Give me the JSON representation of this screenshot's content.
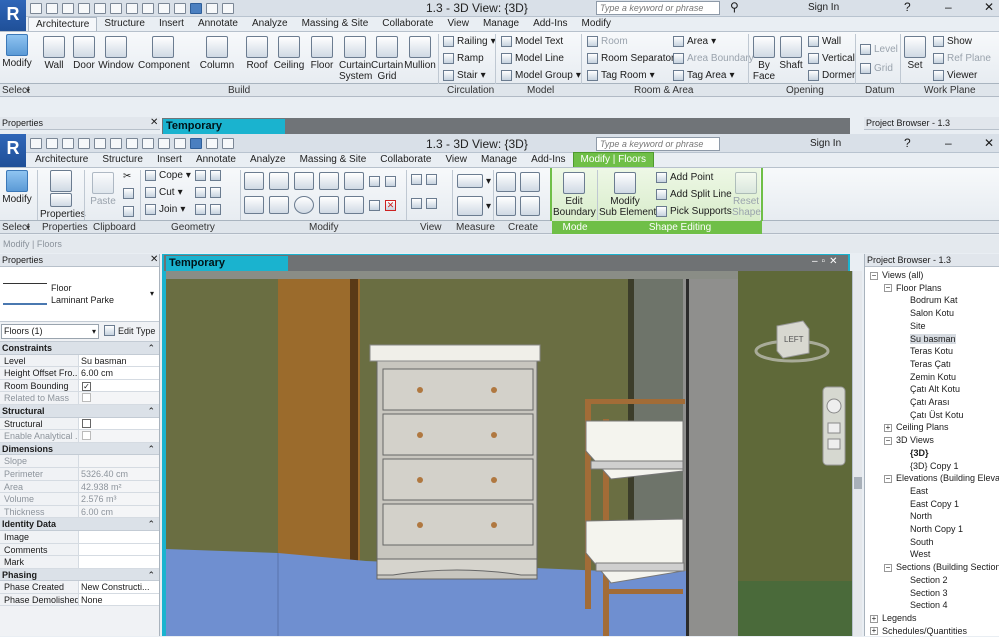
{
  "app": {
    "logo_letter": "R"
  },
  "top_window": {
    "title": "1.3 - 3D View: {3D}",
    "search_placeholder": "Type a keyword or phrase",
    "sign_in": "Sign In",
    "tabs": [
      "Architecture",
      "Structure",
      "Insert",
      "Annotate",
      "Analyze",
      "Massing & Site",
      "Collaborate",
      "View",
      "Manage",
      "Add-Ins",
      "Modify"
    ],
    "active_tab": "Architecture",
    "buttons": {
      "modify": "Modify",
      "wall": "Wall",
      "door": "Door",
      "window": "Window",
      "component": "Component",
      "column": "Column",
      "roof": "Roof",
      "ceiling": "Ceiling",
      "floor": "Floor",
      "curtain_system": "Curtain\nSystem",
      "curtain_grid": "Curtain\nGrid",
      "mullion": "Mullion",
      "railing": "Railing",
      "ramp": "Ramp",
      "stair": "Stair",
      "model_text": "Model  Text",
      "model_line": "Model  Line",
      "model_group": "Model  Group",
      "room": "Room",
      "room_separator": "Room  Separator",
      "tag_room": "Tag  Room",
      "area": "Area",
      "area_boundary": "Area  Boundary",
      "tag_area": "Tag  Area",
      "by_face": "By\nFace",
      "shaft": "Shaft",
      "wall_opening": "Wall",
      "vertical": "Vertical",
      "dormer": "Dormer",
      "level": "Level",
      "grid": "Grid",
      "set": "Set",
      "show": "Show",
      "ref_plane": "Ref  Plane",
      "viewer": "Viewer"
    },
    "panels": {
      "select": "Select",
      "build": "Build",
      "circulation": "Circulation",
      "model": "Model",
      "room_area": "Room & Area",
      "opening": "Opening",
      "datum": "Datum",
      "work_plane": "Work Plane"
    },
    "properties_label": "Properties",
    "view_title": "Temporary Hide/Isolate",
    "project_browser_label": "Project Browser - 1.3"
  },
  "window": {
    "title": "1.3 - 3D View: {3D}",
    "search_placeholder": "Type a keyword or phrase",
    "sign_in": "Sign In",
    "tabs": [
      "Architecture",
      "Structure",
      "Insert",
      "Annotate",
      "Analyze",
      "Massing & Site",
      "Collaborate",
      "View",
      "Manage",
      "Add-Ins",
      "Modify | Floors"
    ],
    "active_tab": "Modify | Floors",
    "buttons": {
      "modify": "Modify",
      "properties": "Properties",
      "paste": "Paste",
      "cope": "Cope",
      "cut": "Cut",
      "join": "Join",
      "edit_boundary": "Edit\nBoundary",
      "modify_sub": "Modify\nSub Elements",
      "add_point": "Add Point",
      "add_split_line": "Add Split Line",
      "pick_supports": "Pick Supports",
      "reset_shape": "Reset\nShape"
    },
    "panels": {
      "select": "Select",
      "properties": "Properties",
      "clipboard": "Clipboard",
      "geometry": "Geometry",
      "modify": "Modify",
      "view": "View",
      "measure": "Measure",
      "create": "Create",
      "mode": "Mode",
      "shape_editing": "Shape Editing"
    },
    "status_line": "Modify | Floors"
  },
  "properties": {
    "header": "Properties",
    "type_family": "Floor",
    "type_name": "Laminant Parke",
    "selector": "Floors (1)",
    "edit_type": "Edit Type",
    "groups": [
      {
        "name": "Constraints",
        "rows": [
          {
            "k": "Level",
            "v": "Su basman",
            "checkbox": false
          },
          {
            "k": "Height Offset Fro...",
            "v": "6.00 cm",
            "checkbox": false
          },
          {
            "k": "Room Bounding",
            "v": "✓",
            "checkbox": true
          },
          {
            "k": "Related to Mass",
            "v": "",
            "checkbox": true,
            "dim": true
          }
        ]
      },
      {
        "name": "Structural",
        "rows": [
          {
            "k": "Structural",
            "v": "",
            "checkbox": true
          },
          {
            "k": "Enable Analytical ...",
            "v": "",
            "checkbox": true,
            "dim": true
          }
        ]
      },
      {
        "name": "Dimensions",
        "rows": [
          {
            "k": "Slope",
            "v": "",
            "dim": true
          },
          {
            "k": "Perimeter",
            "v": "5326.40 cm",
            "dim": true
          },
          {
            "k": "Area",
            "v": "42.938 m²",
            "dim": true
          },
          {
            "k": "Volume",
            "v": "2.576 m³",
            "dim": true
          },
          {
            "k": "Thickness",
            "v": "6.00 cm",
            "dim": true
          }
        ]
      },
      {
        "name": "Identity Data",
        "rows": [
          {
            "k": "Image",
            "v": ""
          },
          {
            "k": "Comments",
            "v": ""
          },
          {
            "k": "Mark",
            "v": ""
          }
        ]
      },
      {
        "name": "Phasing",
        "rows": [
          {
            "k": "Phase Created",
            "v": "New Constructi..."
          },
          {
            "k": "Phase Demolished",
            "v": "None"
          }
        ]
      }
    ]
  },
  "viewport": {
    "title": "Temporary Hide/Isolate",
    "viewcube_face": "LEFT"
  },
  "project_browser": {
    "header": "Project Browser - 1.3",
    "items": [
      {
        "label": "Views (all)",
        "level": 0,
        "toggle": "−"
      },
      {
        "label": "Floor Plans",
        "level": 1,
        "toggle": "−"
      },
      {
        "label": "Bodrum Kat",
        "level": 2
      },
      {
        "label": "Salon Kotu",
        "level": 2
      },
      {
        "label": "Site",
        "level": 2
      },
      {
        "label": "Su basman",
        "level": 2,
        "selected": true
      },
      {
        "label": "Teras Kotu",
        "level": 2
      },
      {
        "label": "Teras Çatı",
        "level": 2
      },
      {
        "label": "Zemin Kotu",
        "level": 2
      },
      {
        "label": "Çatı Alt Kotu",
        "level": 2
      },
      {
        "label": "Çatı Arası",
        "level": 2
      },
      {
        "label": "Çatı Üst Kotu",
        "level": 2
      },
      {
        "label": "Ceiling Plans",
        "level": 1,
        "toggle": "+"
      },
      {
        "label": "3D Views",
        "level": 1,
        "toggle": "−"
      },
      {
        "label": "{3D}",
        "level": 2,
        "bold": true
      },
      {
        "label": "{3D} Copy 1",
        "level": 2
      },
      {
        "label": "Elevations (Building Elevation)",
        "level": 1,
        "toggle": "−"
      },
      {
        "label": "East",
        "level": 2
      },
      {
        "label": "East Copy 1",
        "level": 2
      },
      {
        "label": "North",
        "level": 2
      },
      {
        "label": "North Copy 1",
        "level": 2
      },
      {
        "label": "South",
        "level": 2
      },
      {
        "label": "West",
        "level": 2
      },
      {
        "label": "Sections (Building Section)",
        "level": 1,
        "toggle": "−"
      },
      {
        "label": "Section 2",
        "level": 2
      },
      {
        "label": "Section 3",
        "level": 2
      },
      {
        "label": "Section 4",
        "level": 2
      },
      {
        "label": "Legends",
        "level": 0,
        "toggle": "+"
      },
      {
        "label": "Schedules/Quantities",
        "level": 0,
        "toggle": "+"
      }
    ]
  },
  "colors": {
    "accent": "#1ab3cf",
    "context_tab": "#6fbf47",
    "viewport_wall": "#6d7046",
    "floor_blue": "#6f8fd0"
  }
}
